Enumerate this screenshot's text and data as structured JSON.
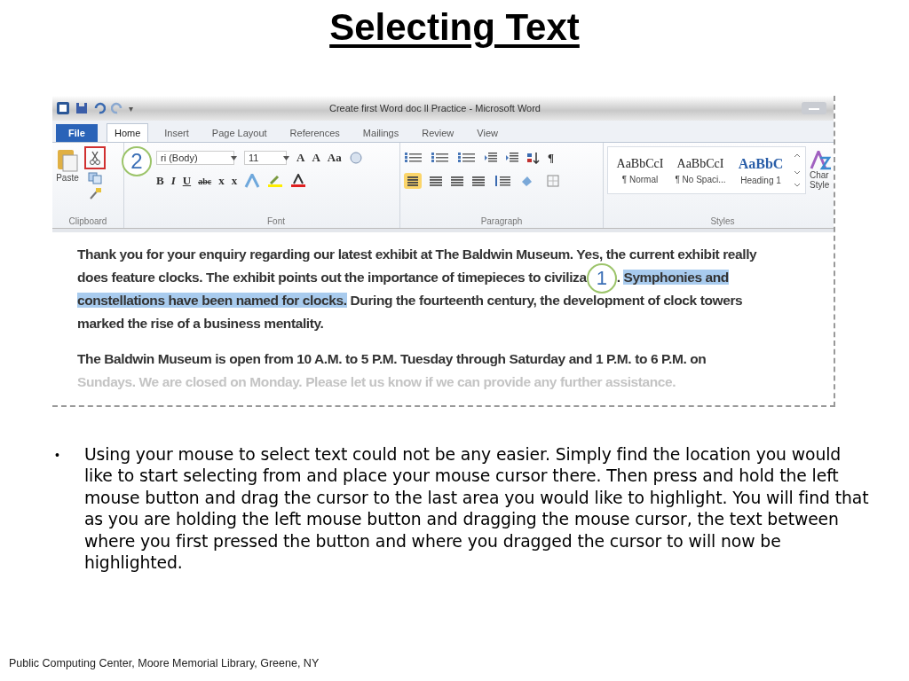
{
  "slide_title": "Selecting Text",
  "word_window": {
    "title": "Create first Word doc ll Practice - Microsoft Word",
    "quick_access": [
      "▾"
    ],
    "tabs": [
      {
        "label": "File",
        "kind": "file",
        "selected": false
      },
      {
        "label": "Home",
        "kind": "tab",
        "selected": true
      },
      {
        "label": "Insert",
        "kind": "tab",
        "selected": false
      },
      {
        "label": "Page Layout",
        "kind": "tab",
        "selected": false
      },
      {
        "label": "References",
        "kind": "tab",
        "selected": false
      },
      {
        "label": "Mailings",
        "kind": "tab",
        "selected": false
      },
      {
        "label": "Review",
        "kind": "tab",
        "selected": false
      },
      {
        "label": "View",
        "kind": "tab",
        "selected": false
      }
    ],
    "clipboard": {
      "paste_label": "Paste",
      "cut_highlighted": true,
      "callout": "2",
      "group_label": "Clipboard"
    },
    "font": {
      "font_name": "ri (Body)",
      "font_size": "11",
      "row1": [
        "A",
        "A",
        "Aa"
      ],
      "row2": [
        "B",
        "I",
        "U",
        "abc",
        "x",
        "x"
      ],
      "group_label": "Font"
    },
    "paragraph": {
      "pilcrow": "¶",
      "group_label": "Paragraph"
    },
    "styles": {
      "tiles": [
        {
          "sample": "AaBbCcI",
          "name": "¶ Normal",
          "kind": "plain"
        },
        {
          "sample": "AaBbCcI",
          "name": "¶ No Spaci...",
          "kind": "plain"
        },
        {
          "sample": "AaBbC",
          "name": "Heading 1",
          "kind": "heading"
        }
      ],
      "change_label": [
        "Char",
        "Style"
      ],
      "group_label": "Styles"
    },
    "document": {
      "callout": "1",
      "paragraphs": [
        {
          "before": "Thank you for your enquiry regarding our latest exhibit at The Baldwin Museum. Yes, the current exhibit really does feature clocks. The exhibit points out the importance of timepieces to civiliza",
          "after_callout": ". ",
          "selected_text": "Symphonies and constellations have been named for clocks.",
          "after": " During the fourteenth century, the development of clock towers marked the rise of a business mentality.",
          "faded": false
        },
        {
          "before": "The Baldwin Museum is open from 10 A.M. to 5 P.M. Tuesday through Saturday and 1 P.M. to 6 P.M. on",
          "faded": false
        },
        {
          "before": "Sundays. We are closed on Monday. Please let us know if we can provide any further assistance.",
          "faded": true
        }
      ]
    }
  },
  "bullets": [
    {
      "marker": "•",
      "text": "Using your mouse to select text could not be any easier. Simply find the location you would like to start selecting from and place your mouse cursor there. Then press and hold the left mouse button and drag the cursor to the last area you would like to highlight. You will find that as you are holding the left mouse button and dragging the mouse cursor, the text between where you first pressed the button and where you dragged the cursor to will now be highlighted."
    }
  ],
  "footer": "Public Computing Center,  Moore Memorial Library, Greene, NY"
}
